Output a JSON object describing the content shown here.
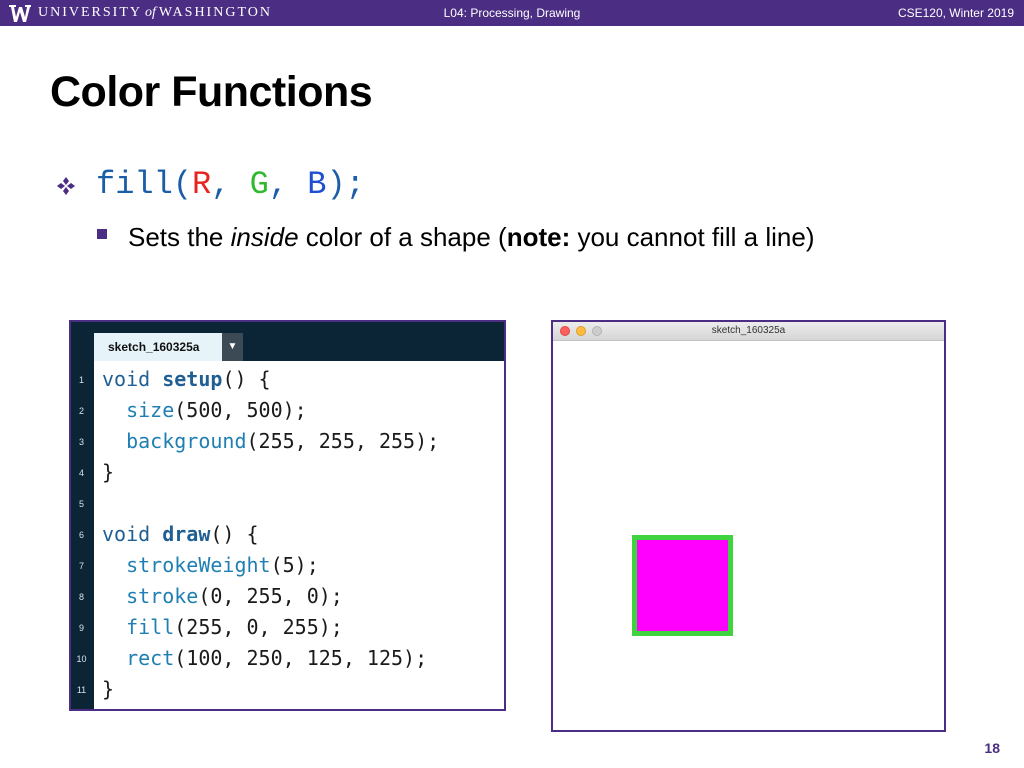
{
  "header": {
    "university": "UNIVERSITY",
    "university_of": "of",
    "university_name": "WASHINGTON",
    "lecture": "L04: Processing, Drawing",
    "course": "CSE120, Winter 2019"
  },
  "slide": {
    "title": "Color Functions",
    "bullet_code": {
      "fn": "fill(",
      "r": "R",
      "sep1": ", ",
      "g": "G",
      "sep2": ", ",
      "b": "B",
      "end": ");"
    },
    "sub_bullet": {
      "text1": "Sets the ",
      "italic": "inside",
      "text2": " color of a shape (",
      "bold": "note:",
      "text3": " you cannot fill a line)"
    },
    "page_number": "18"
  },
  "editor": {
    "tab_label": "sketch_160325a",
    "dropdown_icon": "triangle-down-icon",
    "lines": [
      {
        "num": "1",
        "indent": "",
        "fn": "void ",
        "bold": "setup",
        "rest": "() {"
      },
      {
        "num": "2",
        "indent": "  ",
        "fn": "size",
        "bold": "",
        "rest": "(500, 500);"
      },
      {
        "num": "3",
        "indent": "  ",
        "fn": "background",
        "bold": "",
        "rest": "(255, 255, 255);"
      },
      {
        "num": "4",
        "indent": "",
        "fn": "",
        "bold": "",
        "rest": "}"
      },
      {
        "num": "5",
        "indent": "",
        "fn": "",
        "bold": "",
        "rest": ""
      },
      {
        "num": "6",
        "indent": "",
        "fn": "void ",
        "bold": "draw",
        "rest": "() {"
      },
      {
        "num": "7",
        "indent": "  ",
        "fn": "strokeWeight",
        "bold": "",
        "rest": "(5);"
      },
      {
        "num": "8",
        "indent": "  ",
        "fn": "stroke",
        "bold": "",
        "rest": "(0, 255, 0);"
      },
      {
        "num": "9",
        "indent": "  ",
        "fn": "fill",
        "bold": "",
        "rest": "(255, 0, 255);"
      },
      {
        "num": "10",
        "indent": "  ",
        "fn": "rect",
        "bold": "",
        "rest": "(100, 250, 125, 125);"
      },
      {
        "num": "11",
        "indent": "",
        "fn": "",
        "bold": "",
        "rest": "}"
      }
    ]
  },
  "output_window": {
    "title": "sketch_160325a"
  },
  "colors": {
    "uw_purple": "#4b2e83",
    "code_blue": "#1a5ea8",
    "code_red": "#e8231f",
    "code_green": "#2fb92f",
    "code_bblue": "#1f4fd0",
    "fill_magenta": "#ff00ff",
    "stroke_green": "#3fd43f"
  }
}
